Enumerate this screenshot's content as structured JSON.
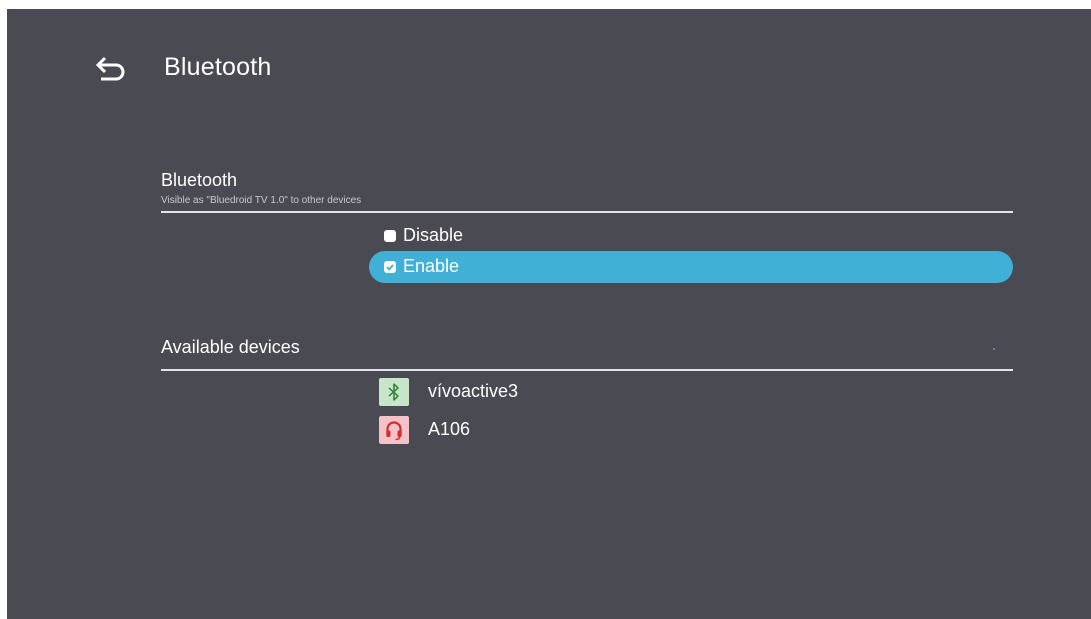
{
  "header": {
    "title": "Bluetooth",
    "back_icon": "back-arrow-icon"
  },
  "bluetooth_section": {
    "title": "Bluetooth",
    "subtitle": "Visible as \"Bluedroid TV 1.0\" to other devices",
    "options": [
      {
        "label": "Disable",
        "checked": false,
        "selected": false
      },
      {
        "label": "Enable",
        "checked": true,
        "selected": true
      }
    ]
  },
  "devices_section": {
    "title": "Available devices",
    "devices": [
      {
        "name": "vívoactive3",
        "icon": "bluetooth-icon",
        "icon_bg": "#c7e6c9",
        "icon_color": "#2e7d32"
      },
      {
        "name": "A106",
        "icon": "headphones-icon",
        "icon_bg": "#f4c2c8",
        "icon_color": "#d32f2f"
      }
    ]
  },
  "colors": {
    "background": "#4a4a52",
    "accent": "#41b0d6",
    "text": "#ffffff"
  }
}
